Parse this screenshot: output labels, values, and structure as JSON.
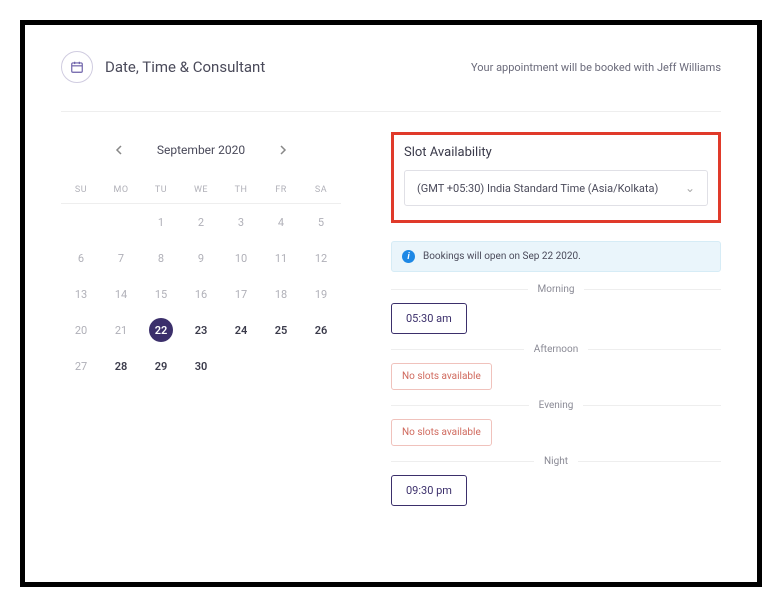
{
  "header": {
    "title": "Date, Time & Consultant",
    "subtitle": "Your appointment will be booked with Jeff Williams"
  },
  "calendar": {
    "month_label": "September 2020",
    "weekdays": [
      "SU",
      "MO",
      "TU",
      "WE",
      "TH",
      "FR",
      "SA"
    ],
    "weeks": [
      [
        {
          "d": ""
        },
        {
          "d": ""
        },
        {
          "d": "1"
        },
        {
          "d": "2"
        },
        {
          "d": "3"
        },
        {
          "d": "4"
        },
        {
          "d": "5"
        }
      ],
      [
        {
          "d": "6"
        },
        {
          "d": "7"
        },
        {
          "d": "8"
        },
        {
          "d": "9"
        },
        {
          "d": "10"
        },
        {
          "d": "11"
        },
        {
          "d": "12"
        }
      ],
      [
        {
          "d": "13"
        },
        {
          "d": "14"
        },
        {
          "d": "15"
        },
        {
          "d": "16"
        },
        {
          "d": "17"
        },
        {
          "d": "18"
        },
        {
          "d": "19"
        }
      ],
      [
        {
          "d": "20"
        },
        {
          "d": "21"
        },
        {
          "d": "22",
          "selected": true,
          "avail": true
        },
        {
          "d": "23",
          "avail": true
        },
        {
          "d": "24",
          "avail": true
        },
        {
          "d": "25",
          "avail": true
        },
        {
          "d": "26",
          "avail": true
        }
      ],
      [
        {
          "d": "27"
        },
        {
          "d": "28",
          "avail": true
        },
        {
          "d": "29",
          "avail": true
        },
        {
          "d": "30",
          "avail": true
        },
        {
          "d": ""
        },
        {
          "d": ""
        },
        {
          "d": ""
        }
      ]
    ]
  },
  "slots": {
    "section_title": "Slot Availability",
    "timezone": "(GMT +05:30) India Standard Time (Asia/Kolkata)",
    "info": "Bookings will open on Sep 22 2020.",
    "no_slots_text": "No slots available",
    "periods": [
      {
        "label": "Morning",
        "slots": [
          "05:30 am"
        ],
        "empty": false
      },
      {
        "label": "Afternoon",
        "slots": [],
        "empty": true
      },
      {
        "label": "Evening",
        "slots": [],
        "empty": true
      },
      {
        "label": "Night",
        "slots": [
          "09:30 pm"
        ],
        "empty": false
      }
    ]
  }
}
